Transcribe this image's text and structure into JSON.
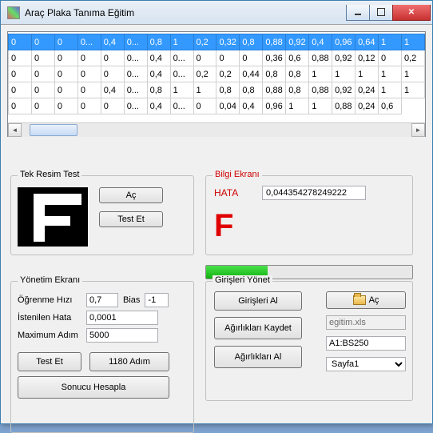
{
  "window": {
    "title": "Araç Plaka Tanıma Eğitim"
  },
  "grid": {
    "rows": [
      [
        "0",
        "0",
        "0",
        "0...",
        "0,4",
        "0...",
        "0,8",
        "1",
        "0,2",
        "0,32",
        "0,8",
        "0,88",
        "0,92",
        "0,4",
        "0,96",
        "0,64",
        "1",
        "1"
      ],
      [
        "0",
        "0",
        "0",
        "0",
        "0",
        "0...",
        "0,4",
        "0...",
        "0",
        "0",
        "0",
        "0,36",
        "0,6",
        "0,88",
        "0,92",
        "0,12",
        "0",
        "0,2"
      ],
      [
        "0",
        "0",
        "0",
        "0",
        "0",
        "0...",
        "0,4",
        "0...",
        "0,2",
        "0,2",
        "0,44",
        "0,8",
        "0,8",
        "1",
        "1",
        "1",
        "1",
        "1"
      ],
      [
        "0",
        "0",
        "0",
        "0",
        "0,4",
        "0...",
        "0,8",
        "1",
        "1",
        "0,8",
        "0,8",
        "0,88",
        "0,8",
        "0,88",
        "0,92",
        "0,24",
        "1",
        "1"
      ],
      [
        "0",
        "0",
        "0",
        "0",
        "0",
        "0...",
        "0,4",
        "0...",
        "0",
        "0,04",
        "0,4",
        "0,96",
        "1",
        "1",
        "0,88",
        "0,24",
        "0,6"
      ]
    ]
  },
  "tek": {
    "legend": "Tek Resim Test",
    "open": "Aç",
    "test": "Test Et"
  },
  "bilgi": {
    "legend": "Bilgi Ekranı",
    "hata_label": "HATA",
    "hata_value": "0,044354278249222",
    "result": "F"
  },
  "progress": {
    "percent": 30
  },
  "yonetim": {
    "legend": "Yönetim Ekranı",
    "ogrenme_label": "Öğrenme Hızı",
    "ogrenme_val": "0,7",
    "bias_label": "Bias",
    "bias_val": "-1",
    "istenilen_label": "İstenilen Hata",
    "istenilen_val": "0,0001",
    "max_label": "Maximum Adım",
    "max_val": "5000",
    "testet": "Test Et",
    "adim": "1180 Adım",
    "sonuc": "Sonucu Hesapla"
  },
  "giris": {
    "legend": "Girişleri Yönet",
    "girisleri_al": "Girişleri Al",
    "agirlik_kaydet": "Ağırlıkları Kaydet",
    "agirlik_al": "Ağırlıkları Al",
    "ac": "Aç",
    "file": "egitim.xls",
    "range": "A1:BS250",
    "sheet": "Sayfa1"
  }
}
